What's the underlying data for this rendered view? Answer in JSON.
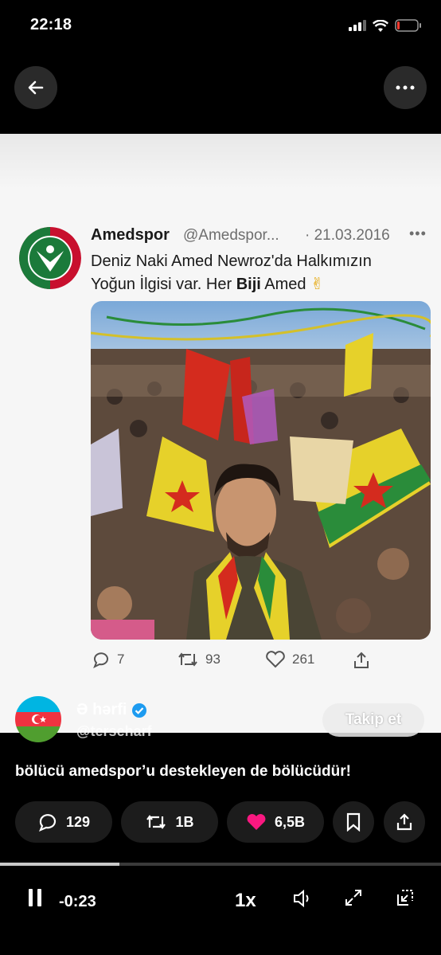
{
  "status_bar": {
    "time": "22:18"
  },
  "tweet": {
    "name": "Amedspor",
    "handle": "@Amedspor...",
    "date": "· 21.03.2016",
    "text_line1": "Deniz Naki Amed Newroz'da Halkımızın",
    "text_line2_a": "Yoğun İlgisi var. Her ",
    "text_line2_bold": "Biji",
    "text_line2_b": " Amed",
    "text_emoji": "✌",
    "replies": "7",
    "retweets": "93",
    "likes": "261"
  },
  "post": {
    "author_name": "Ə hərfi",
    "author_handle": "@terseharf",
    "follow_label": "Takip et",
    "caption": "bölücü amedspor’u destekleyen de bölücüdür!",
    "replies": "129",
    "reposts": "1B",
    "likes": "6,5B",
    "like_color": "#f91880"
  },
  "player": {
    "remaining": "-0:23",
    "speed": "1x",
    "progress": 0.27
  },
  "colors": {
    "verified": "#1d9bf0",
    "background": "#000000"
  }
}
